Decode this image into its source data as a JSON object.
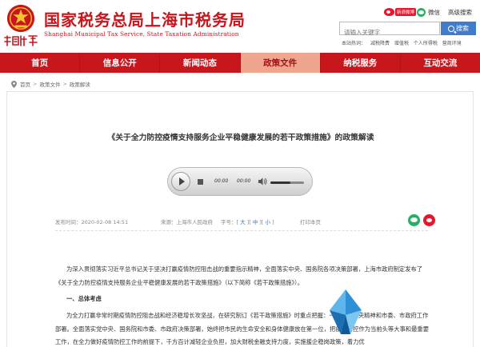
{
  "header": {
    "site_title": "国家税务总局上海市税务局",
    "site_subtitle": "Shanghai Municipal Tax Service, State Taxation Administration",
    "seal_text": "中國稅務",
    "social": {
      "weibo_label": "新浪微博",
      "wechat_label": "微信",
      "accessibility_label": "高级搜索"
    },
    "search": {
      "placeholder": "请输入关键字",
      "button_label": "搜索"
    },
    "hot_search": [
      "本站热词：",
      "减税降费",
      "增值税",
      "个人所得税",
      "营商环境"
    ]
  },
  "nav": {
    "items": [
      {
        "label": "首页"
      },
      {
        "label": "信息公开"
      },
      {
        "label": "新闻动态"
      },
      {
        "label": "政策文件"
      },
      {
        "label": "纳税服务"
      },
      {
        "label": "互动交流"
      }
    ],
    "active_index": 3
  },
  "breadcrumb": {
    "items": [
      "首页",
      "政策文件",
      "政策解读"
    ],
    "separator": ">"
  },
  "article": {
    "title": "《关于全力防控疫情支持服务企业平稳健康发展的若干政策措施》的政策解读",
    "audio": {
      "time_current": "00:00",
      "time_total": "00:00",
      "volume_level": 0.6
    },
    "meta": {
      "date": "发布时间：2020-02-08 14:51",
      "source": "来源：上海市人民政府",
      "font_size_label": "字号：",
      "font_large": "大",
      "font_medium": "中",
      "font_small": "小",
      "print_label": "打印本页"
    },
    "para1": "为深入贯彻落实习近平总书记关于坚决打赢疫情防控阻击战的重要指示精神，全面落实中央、国务院各项决策部署，上海市政府制定发布了《关于全力防控疫情支持服务企业平稳健康发展的若干政策措施》（以下简称《若干政策措施》）。",
    "section_heading": "一、总体考虑",
    "para2": "为全力打赢非常时期疫情防控阻击战和经济稳增长攻坚战，在研究制订《若干政策措施》时重点把握：一是落实中央精神和市委、市政府工作部署。全面落实党中央、国务院和市委、市政府决策部署，始终把市民的生命安全和身体健康放在第一位，把疫情防控作为当前头等大事和最重要工作，在全力做好疫情防控工作的前提下，千方百计减轻企业负担，加大财税金融支持力度，实施援企稳岗政策，着力优"
  }
}
